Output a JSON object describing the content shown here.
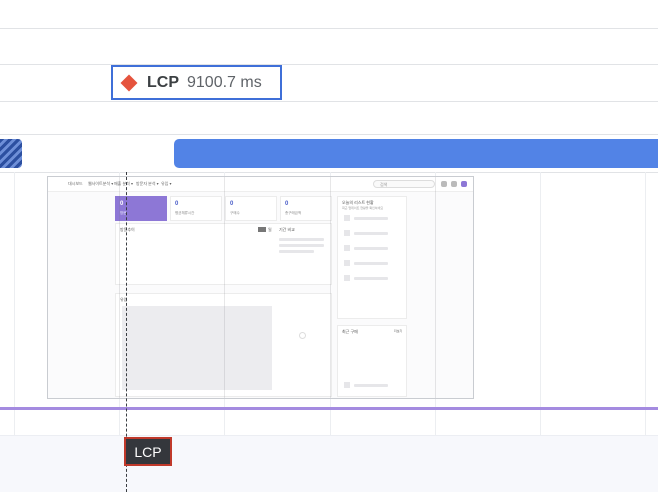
{
  "lcp_tooltip": {
    "metric": "LCP",
    "value": "9100.7 ms",
    "marker_color": "#e5533d",
    "border_color": "#3f6fd8"
  },
  "tracks": {
    "bar_color": "#5283e6",
    "hatch_color": "#2c4fa0"
  },
  "thumbnail": {
    "nav_items": [
      "대시보드",
      "웹사이트분석 ▾",
      "매출 분석 ▾",
      "방문자 분석 ▾",
      "유입 ▾"
    ],
    "search_placeholder": "검색",
    "cards": [
      {
        "num": "0",
        "label": "방문"
      },
      {
        "num": "0",
        "label": "평균체류시간"
      },
      {
        "num": "0",
        "label": "구매수"
      },
      {
        "num": "0",
        "label": "총구매금액"
      }
    ],
    "panel_left_title": "방문추이",
    "panel_left_tag": "일",
    "panel_left_sub": "기간 비교",
    "panel_lower_title": "유입",
    "side_title": "오늘의 리스트 현황",
    "side_sub": "최근 업데이트 현황을 확인하세요",
    "side_lower_title": "최근 구매",
    "side_lower_more": "더보기"
  },
  "lcp_marker": {
    "label": "LCP"
  }
}
